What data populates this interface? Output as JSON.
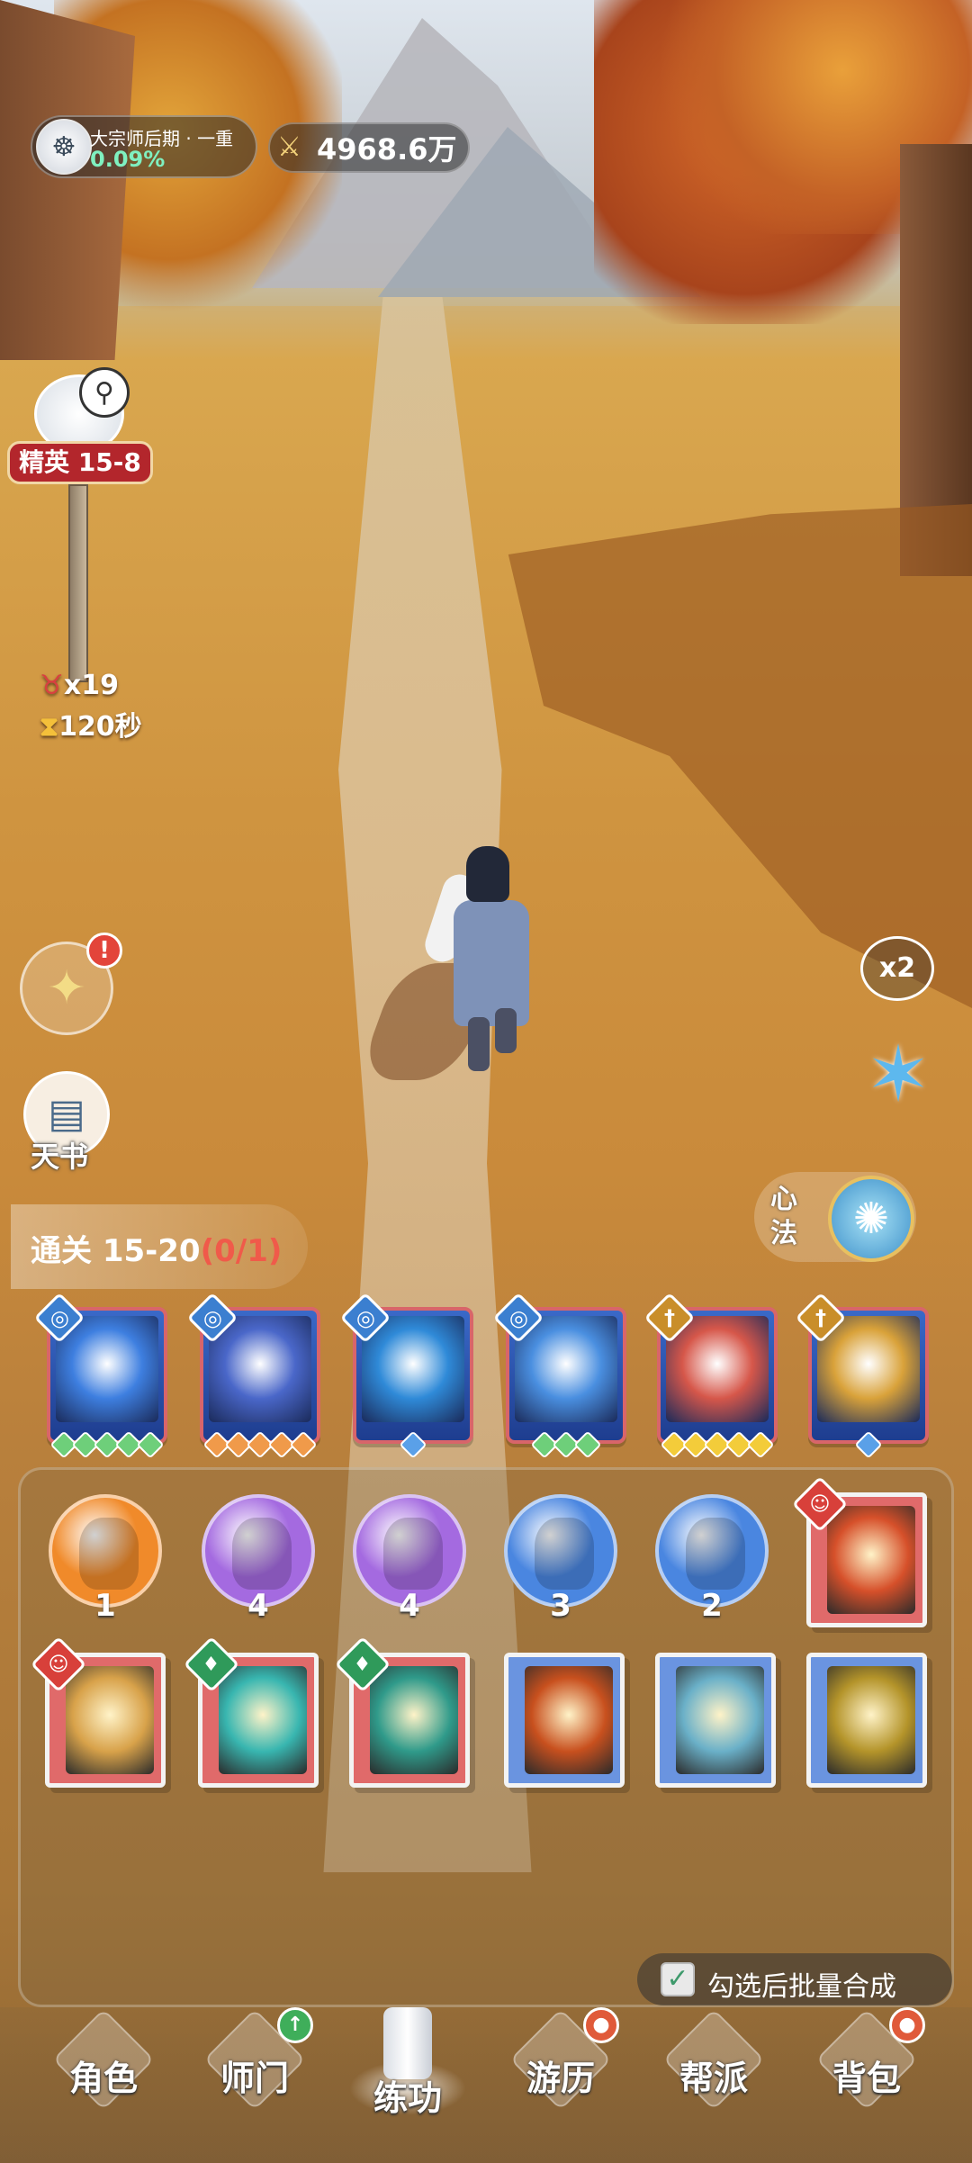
{
  "hud": {
    "rank_name": "大宗师后期 · 一重",
    "rank_progress": "0.09%",
    "power": "4968.6万"
  },
  "stage": {
    "badge": "精英 15-8",
    "enemy_count": "x19",
    "time_left": "120秒"
  },
  "side": {
    "bag_alert": "!",
    "book_label": "天书",
    "speed": "x2",
    "xinfa_label": "心法"
  },
  "objective": {
    "label": "通关 15-20",
    "progress": "(0/1)"
  },
  "skill_cards": [
    {
      "element": "water",
      "gem_color": "#6ecf7a",
      "gems": 5,
      "art_color": "#3e7fe0"
    },
    {
      "element": "water",
      "gem_color": "#f09a4a",
      "gems": 5,
      "art_color": "#4a67c9"
    },
    {
      "element": "water",
      "gem_color": "#5aa0e8",
      "gems": 1,
      "art_color": "#2f8ad8"
    },
    {
      "element": "water",
      "gem_color": "#6ecf7a",
      "gems": 3,
      "art_color": "#4a8fe0"
    },
    {
      "element": "metal",
      "gem_color": "#f3cc3a",
      "gems": 5,
      "art_color": "#d6574a"
    },
    {
      "element": "metal",
      "gem_color": "#5aa0e8",
      "gems": 1,
      "art_color": "#d9a23a"
    }
  ],
  "orbs": [
    {
      "count": "1",
      "color": "#f08a2a"
    },
    {
      "count": "4",
      "color": "#a46ae0"
    },
    {
      "count": "4",
      "color": "#a46ae0"
    },
    {
      "count": "3",
      "color": "#4a86e0"
    },
    {
      "count": "2",
      "color": "#4a86e0"
    }
  ],
  "books": [
    {
      "frame": "#e06a6a",
      "art": "#d6502a",
      "mark": "meditate"
    },
    {
      "frame": "#e06a6a",
      "art": "#d8a24a",
      "mark": "meditate"
    },
    {
      "frame": "#e06a6a",
      "art": "#38b6b0",
      "mark": "wood"
    },
    {
      "frame": "#e06a6a",
      "art": "#2f9a8a",
      "mark": "wood"
    },
    {
      "frame": "#6a94e0",
      "art": "#c8501e",
      "mark": ""
    },
    {
      "frame": "#6a94e0",
      "art": "#6ab0c8",
      "mark": ""
    },
    {
      "frame": "#6a94e0",
      "art": "#b4942a",
      "mark": ""
    }
  ],
  "batch": {
    "checked": "✓",
    "label": "勾选后批量合成"
  },
  "nav": [
    {
      "label": "角色",
      "badge": ""
    },
    {
      "label": "师门",
      "badge": "↑"
    },
    {
      "label": "练功",
      "badge": ""
    },
    {
      "label": "游历",
      "badge": "●"
    },
    {
      "label": "帮派",
      "badge": ""
    },
    {
      "label": "背包",
      "badge": "●"
    }
  ]
}
